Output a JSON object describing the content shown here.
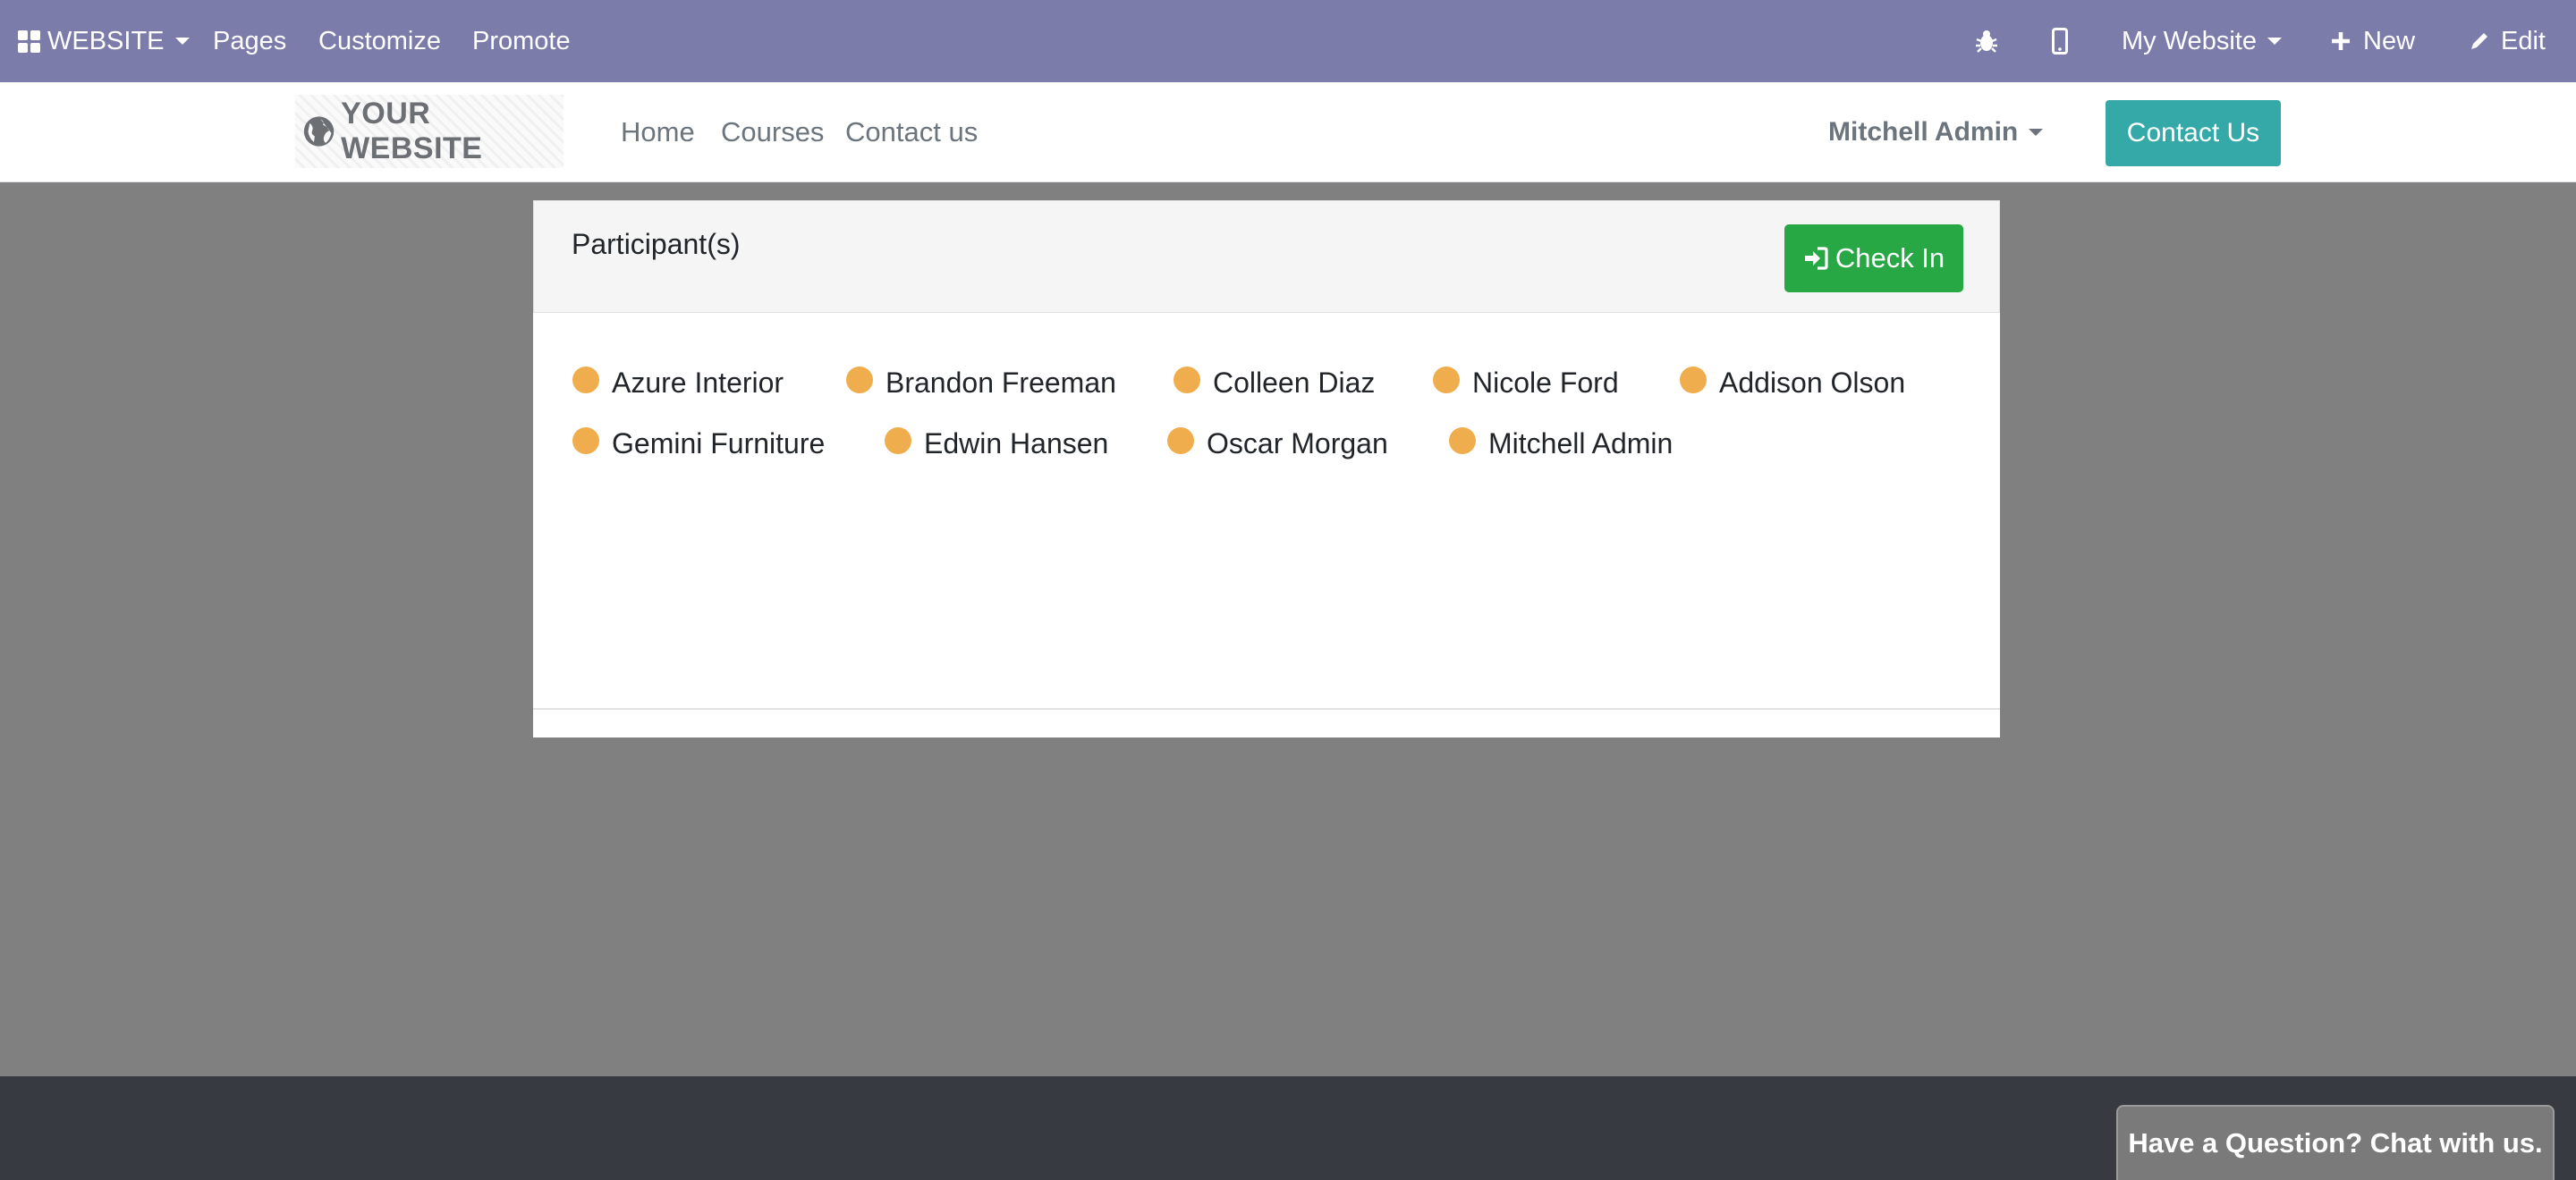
{
  "admin_bar": {
    "app_menu_label": "WEBSITE",
    "menu_items": [
      "Pages",
      "Customize",
      "Promote"
    ],
    "website_selector": "My Website",
    "new_label": "New",
    "edit_label": "Edit",
    "icons": [
      "apps-icon",
      "bug-icon",
      "mobile-icon",
      "plus-icon",
      "pencil-icon"
    ]
  },
  "site_nav": {
    "logo_text": "YOUR WEBSITE",
    "links": [
      "Home",
      "Courses",
      "Contact us"
    ],
    "user_name": "Mitchell Admin",
    "contact_button": "Contact Us"
  },
  "card": {
    "title": "Participant(s)",
    "checkin_label": "Check In",
    "participants": [
      "Azure Interior",
      "Brandon Freeman",
      "Colleen Diaz",
      "Nicole Ford",
      "Addison Olson",
      "Gemini Furniture",
      "Edwin Hansen",
      "Oscar Morgan",
      "Mitchell Admin"
    ],
    "status_color": "#f0ad4e"
  },
  "footer": {
    "chat_label": "Have a Question? Chat with us."
  },
  "colors": {
    "admin_bar": "#7b7caa",
    "contact_button": "#35a9a8",
    "checkin_button": "#28a745",
    "footer": "#373a40",
    "backdrop": "#808080"
  }
}
